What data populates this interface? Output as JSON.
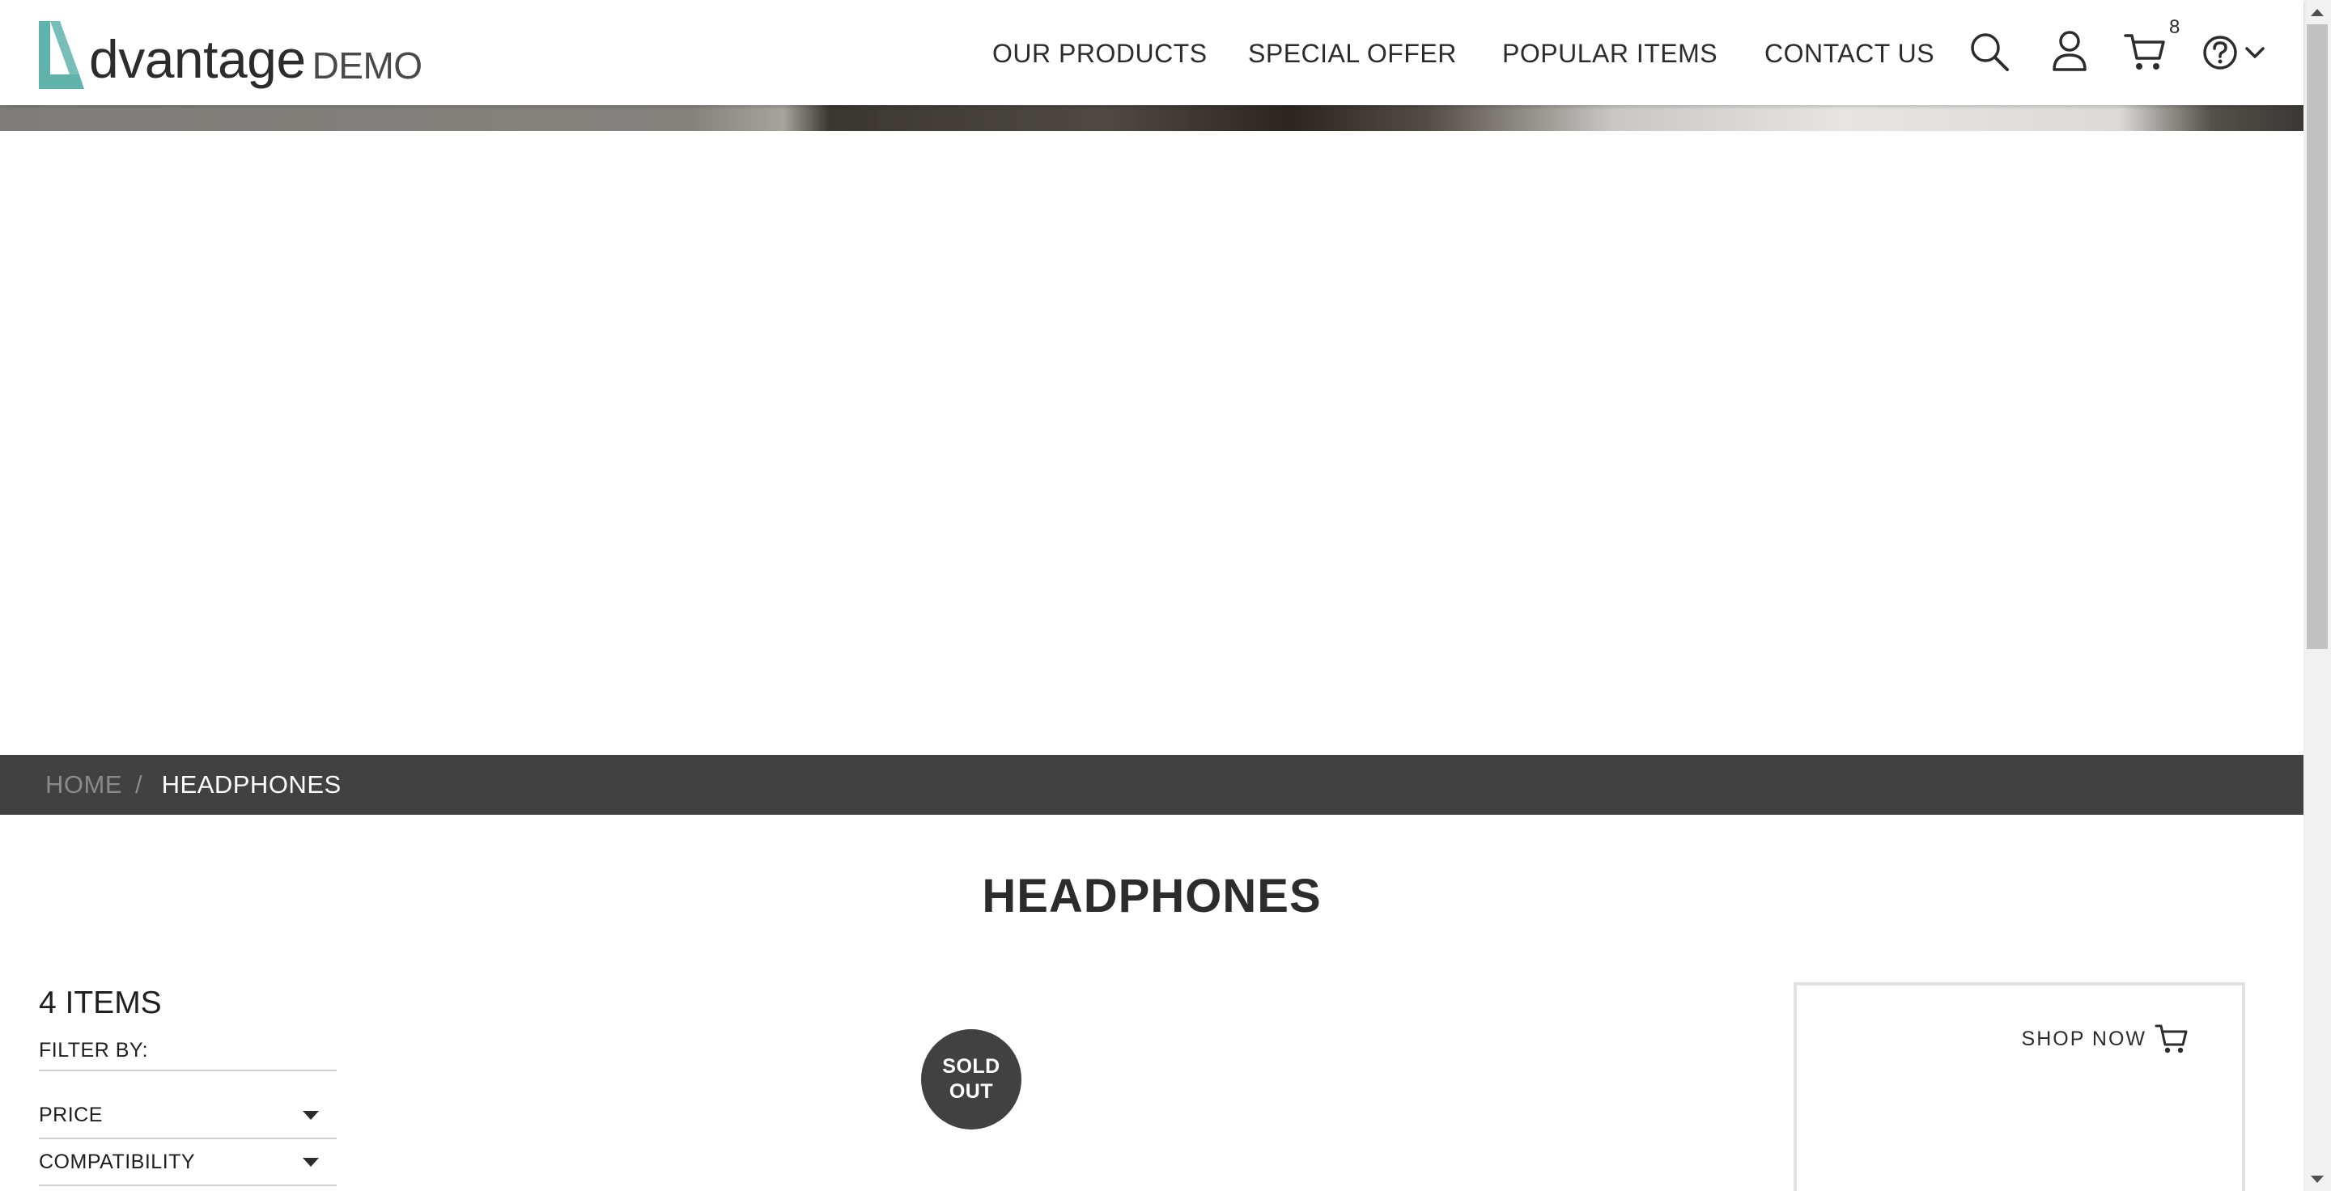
{
  "brand": {
    "logo_word": "dvantage",
    "logo_suffix": "DEMO",
    "accent_color": "#5fb3ab"
  },
  "nav": {
    "items": [
      {
        "label": "OUR PRODUCTS"
      },
      {
        "label": "SPECIAL OFFER"
      },
      {
        "label": "POPULAR ITEMS"
      },
      {
        "label": "CONTACT US"
      }
    ]
  },
  "header_icons": {
    "search": "search-icon",
    "user": "user-icon",
    "cart": "cart-icon",
    "cart_count": "8",
    "help": "help-icon"
  },
  "breadcrumb": {
    "home": "HOME",
    "separator": "/",
    "current": "HEADPHONES"
  },
  "page": {
    "title": "HEADPHONES"
  },
  "filters": {
    "items_count": "4 ITEMS",
    "filter_by": "FILTER BY:",
    "options": [
      {
        "label": "PRICE"
      },
      {
        "label": "COMPATIBILITY"
      }
    ]
  },
  "product": {
    "badge_line1": "SOLD",
    "badge_line2": "OUT"
  },
  "promo": {
    "shop_now_label": "SHOP NOW"
  }
}
